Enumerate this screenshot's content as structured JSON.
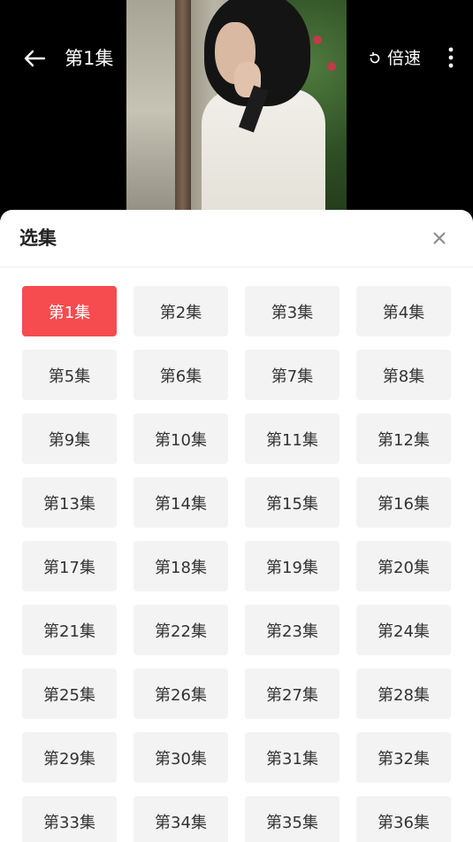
{
  "header": {
    "back_icon": "back-arrow-icon",
    "title": "第1集",
    "speed_icon": "rotate-icon",
    "speed_label": "倍速",
    "more_icon": "more-vertical-icon"
  },
  "sheet": {
    "title": "选集",
    "close_icon": "close-icon",
    "selected_index": 0,
    "accent_color": "#f64b4f",
    "episodes": [
      "第1集",
      "第2集",
      "第3集",
      "第4集",
      "第5集",
      "第6集",
      "第7集",
      "第8集",
      "第9集",
      "第10集",
      "第11集",
      "第12集",
      "第13集",
      "第14集",
      "第15集",
      "第16集",
      "第17集",
      "第18集",
      "第19集",
      "第20集",
      "第21集",
      "第22集",
      "第23集",
      "第24集",
      "第25集",
      "第26集",
      "第27集",
      "第28集",
      "第29集",
      "第30集",
      "第31集",
      "第32集",
      "第33集",
      "第34集",
      "第35集",
      "第36集"
    ]
  }
}
